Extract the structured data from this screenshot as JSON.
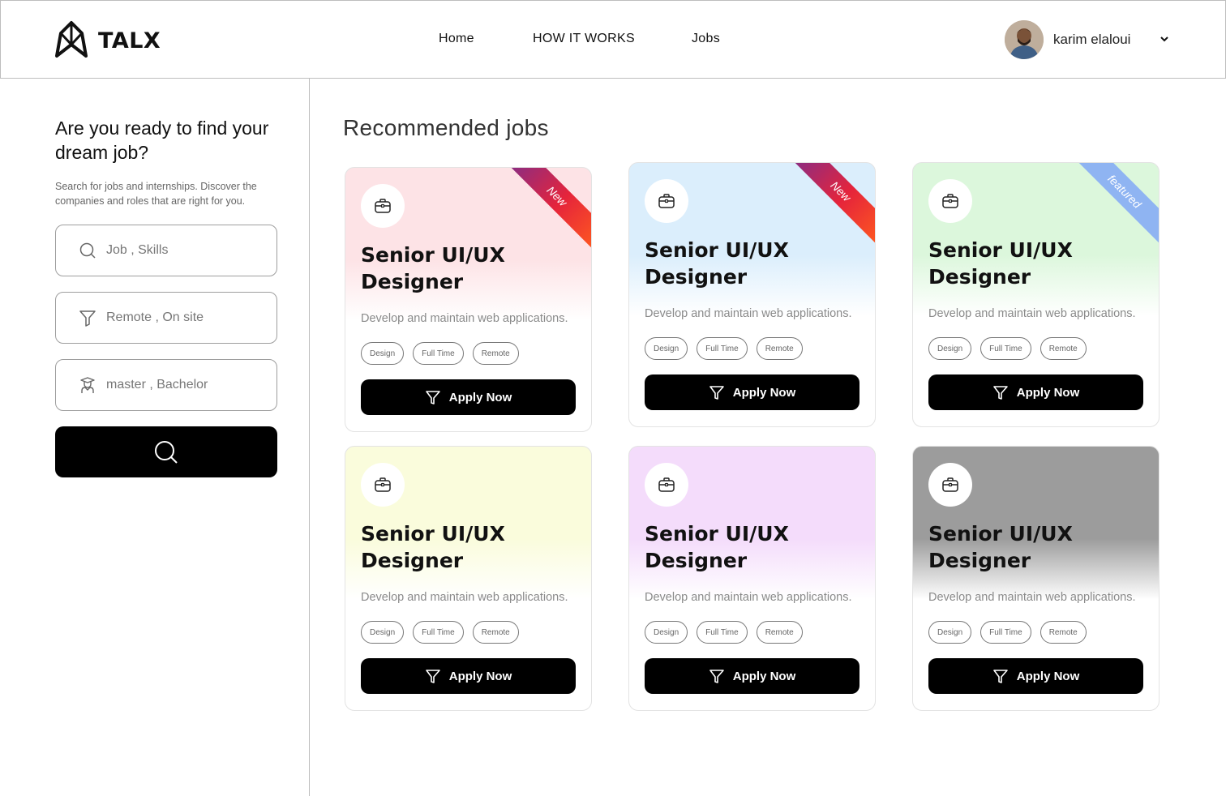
{
  "header": {
    "brand": "TALX",
    "nav": [
      {
        "label": "Home"
      },
      {
        "label": "HOW IT WORKS"
      },
      {
        "label": "Jobs"
      }
    ],
    "user": {
      "name": "karim elaloui"
    }
  },
  "sidebar": {
    "title": "Are you ready to find your dream job?",
    "description": "Search for jobs and internships. Discover the companies and roles that are right for you.",
    "fields": [
      {
        "icon": "search-icon",
        "placeholder": "Job , Skills"
      },
      {
        "icon": "filter-icon",
        "placeholder": "Remote , On site"
      },
      {
        "icon": "graduate-icon",
        "placeholder": "master , Bachelor"
      }
    ]
  },
  "main": {
    "title": "Recommended jobs",
    "cards": [
      {
        "title": "Senior UI/UX Designer",
        "description": "Develop and maintain web applications.",
        "tags": [
          "Design",
          "Full Time",
          "Remote"
        ],
        "button": "Apply Now",
        "badge": "New",
        "gradient": "#fde3e6"
      },
      {
        "title": "Senior UI/UX Designer",
        "description": "Develop and maintain web applications.",
        "tags": [
          "Design",
          "Full Time",
          "Remote"
        ],
        "button": "Apply Now",
        "badge": "New",
        "gradient": "#dbeefc"
      },
      {
        "title": "Senior UI/UX Designer",
        "description": "Develop and maintain web applications.",
        "tags": [
          "Design",
          "Full Time",
          "Remote"
        ],
        "button": "Apply Now",
        "badge": "featured",
        "gradient": "#dcf7dc"
      },
      {
        "title": "Senior UI/UX Designer",
        "description": "Develop and maintain web applications.",
        "tags": [
          "Design",
          "Full Time",
          "Remote"
        ],
        "button": "Apply Now",
        "badge": "",
        "gradient": "#fafcdc"
      },
      {
        "title": "Senior UI/UX Designer",
        "description": "Develop and maintain web applications.",
        "tags": [
          "Design",
          "Full Time",
          "Remote"
        ],
        "button": "Apply Now",
        "badge": "",
        "gradient": "#f4dcfb"
      },
      {
        "title": "Senior UI/UX Designer",
        "description": "Develop and maintain web applications.",
        "tags": [
          "Design",
          "Full Time",
          "Remote"
        ],
        "button": "Apply Now",
        "badge": "",
        "gradient": "#9c9c9c"
      }
    ]
  }
}
